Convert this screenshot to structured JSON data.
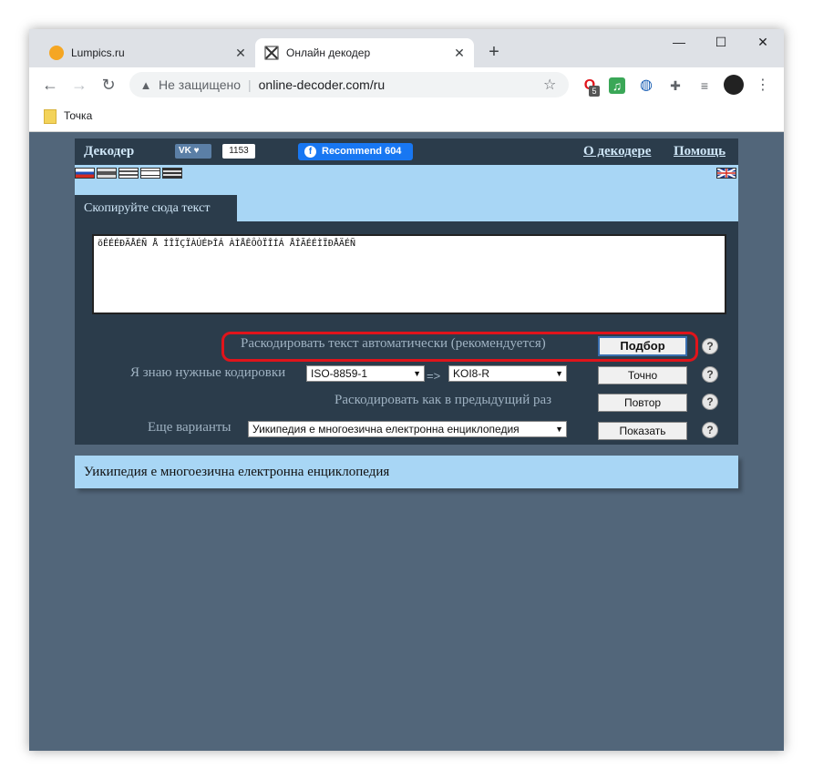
{
  "browser": {
    "tabs": [
      {
        "title": "Lumpics.ru",
        "active": false
      },
      {
        "title": "Онлайн декодер",
        "active": true
      }
    ],
    "newtab_symbol": "+",
    "window_controls": {
      "minimize": "—",
      "maximize": "☐",
      "close": "✕"
    },
    "address": {
      "security": "Не защищено",
      "url": "online-decoder.com/ru"
    },
    "extensions": {
      "badge_count": "5"
    },
    "bookmarks": [
      {
        "label": "Точка"
      }
    ]
  },
  "page": {
    "brand": "Декодер",
    "vk_label": "VK",
    "vk_count": "1153",
    "fb_label": "Recommend 604",
    "links": {
      "about": "О декодере",
      "help": "Помощь"
    },
    "panel_tab": "Скопируйте сюда текст",
    "input_text": "õÊÉÉÐÄÅÉÑ Å ÍÎÏÇÏÀÚÉÞÎÁ ÀÌÅÊÔÒÏÎÍÁ ÅÎÃÉÉÌÏÐÅÄÉÑ",
    "rows": {
      "auto": {
        "label": "Раскодировать текст автоматически (рекомендуется)",
        "button": "Подбор"
      },
      "known": {
        "label": "Я знаю нужные кодировки",
        "from": "ISO-8859-1",
        "arrow": "=>",
        "to": "KOI8-R",
        "button": "Точно"
      },
      "repeat": {
        "label": "Раскодировать как в предыдущий раз",
        "button": "Повтор"
      },
      "more": {
        "label": "Еще варианты",
        "option": "Уикипедия е многоезична електронна енциклопедия",
        "button": "Показать"
      }
    },
    "help_symbol": "?",
    "result": "Уикипедия е многоезична електронна енциклопедия"
  },
  "colors": {
    "page_bg": "#52667a",
    "panel_bg": "#2b3c4b",
    "band_bg": "#a8d6f5",
    "highlight": "#e0141b"
  }
}
